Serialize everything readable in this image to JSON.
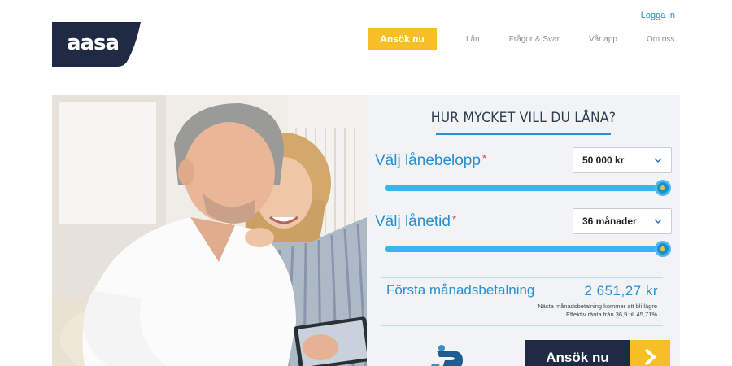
{
  "brand": {
    "logo_text": "aasa"
  },
  "header": {
    "login_label": "Logga in",
    "cta_label": "Ansök nu",
    "nav": [
      "Lån",
      "Frågor & Svar",
      "Vår app",
      "Om oss"
    ]
  },
  "hero": {
    "image_alt": "couple-with-tablet-photo"
  },
  "calculator": {
    "title": "HUR MYCKET VILL DU LÅNA?",
    "amount": {
      "label": "Välj lånebelopp",
      "required_mark": "*",
      "value": "50 000 kr",
      "slider_level": 1.0
    },
    "term": {
      "label": "Välj lånetid",
      "required_mark": "*",
      "value": "36 månader",
      "slider_level": 1.0
    },
    "payment": {
      "label": "Första månadsbetalning",
      "amount": "2 651,27 kr",
      "note1": "Nästa månadsbetalning kommer att bli lägre",
      "note2": "Effektiv ränta från 36,9 till 45,71%"
    },
    "apply_label": "Ansök nu",
    "bankid_icon": "bankid-icon"
  },
  "colors": {
    "accent_blue": "#2a8fd0",
    "cta_yellow": "#f7bf26",
    "navy": "#1f2a44",
    "slider_blue": "#3ab4ec"
  }
}
